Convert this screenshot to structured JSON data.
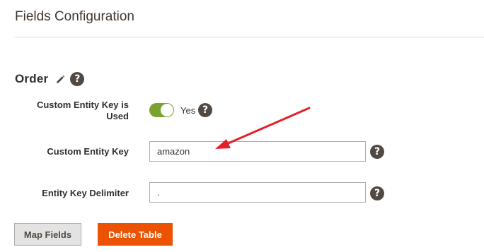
{
  "section": {
    "title": "Fields Configuration"
  },
  "group": {
    "title": "Order",
    "edit_icon": "pencil-icon",
    "help_icon": "question-mark-icon"
  },
  "fields": {
    "custom_entity_key_used": {
      "label": "Custom Entity Key is Used",
      "toggle_state": "on",
      "toggle_text": "Yes"
    },
    "custom_entity_key": {
      "label": "Custom Entity Key",
      "value": "amazon"
    },
    "entity_key_delimiter": {
      "label": "Entity Key Delimiter",
      "value": "."
    }
  },
  "buttons": {
    "map_fields": "Map Fields",
    "delete_table": "Delete Table"
  },
  "help_glyph": "?",
  "colors": {
    "toggle_on": "#79a22e",
    "primary_button": "#eb5202",
    "annotation_arrow": "#e3202a",
    "help_icon": "#514943"
  }
}
